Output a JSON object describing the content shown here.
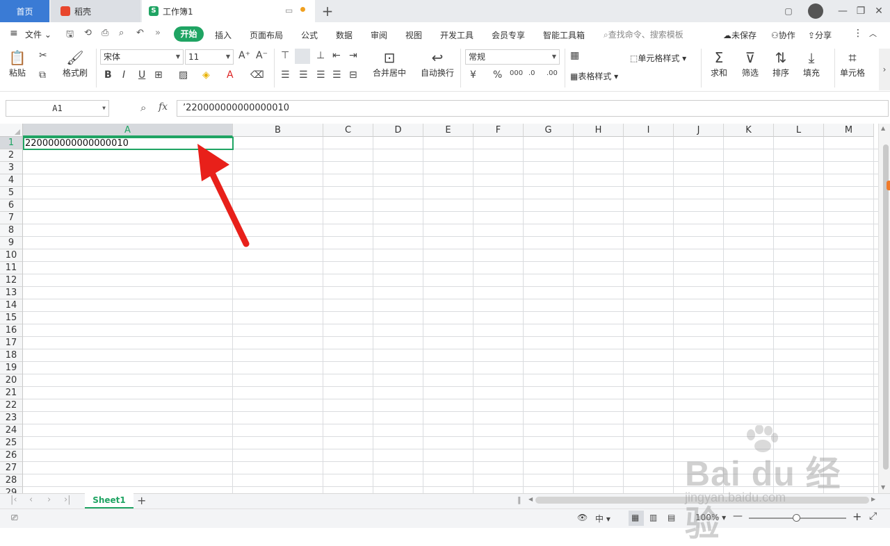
{
  "tabs": {
    "home": "首页",
    "daoke": "稻壳",
    "workbook": "工作簿1"
  },
  "menu": {
    "file": "文件",
    "start": "开始",
    "insert": "插入",
    "page_layout": "页面布局",
    "formula": "公式",
    "data": "数据",
    "review": "审阅",
    "view": "视图",
    "dev_tools": "开发工具",
    "member": "会员专享",
    "smart_tools": "智能工具箱",
    "search_placeholder": "查找命令、搜索模板",
    "unsaved": "未保存",
    "collaborate": "协作",
    "share": "分享"
  },
  "ribbon": {
    "paste": "粘贴",
    "format_painter": "格式刷",
    "font_name": "宋体",
    "font_size": "11",
    "merge_center": "合并居中",
    "wrap_text": "自动换行",
    "number_format": "常规",
    "cell_style": "单元格样式",
    "table_style": "表格样式",
    "sum": "求和",
    "filter": "筛选",
    "sort": "排序",
    "fill": "填充",
    "cell": "单元格"
  },
  "formula_bar": {
    "name_box": "A1",
    "content": "’220000000000000010"
  },
  "columns": [
    "A",
    "B",
    "C",
    "D",
    "E",
    "F",
    "G",
    "H",
    "I",
    "J",
    "K",
    "L",
    "M"
  ],
  "rows": [
    "1",
    "2",
    "3",
    "4",
    "5",
    "6",
    "7",
    "8",
    "9",
    "10",
    "11",
    "12",
    "13",
    "14",
    "15",
    "16",
    "17",
    "18",
    "19",
    "20",
    "21",
    "22",
    "23",
    "24",
    "25",
    "26",
    "27",
    "28",
    "29"
  ],
  "cell_a1": "220000000000000010",
  "sheet_tab": "Sheet1",
  "status": {
    "zoom": "100%"
  },
  "watermark": {
    "main": "Bai du 经验",
    "sub": "jingyan.baidu.com"
  },
  "colors": {
    "accent_green": "#1fa463",
    "home_tab_blue": "#3a7bd5",
    "arrow_red": "#e8201a"
  }
}
